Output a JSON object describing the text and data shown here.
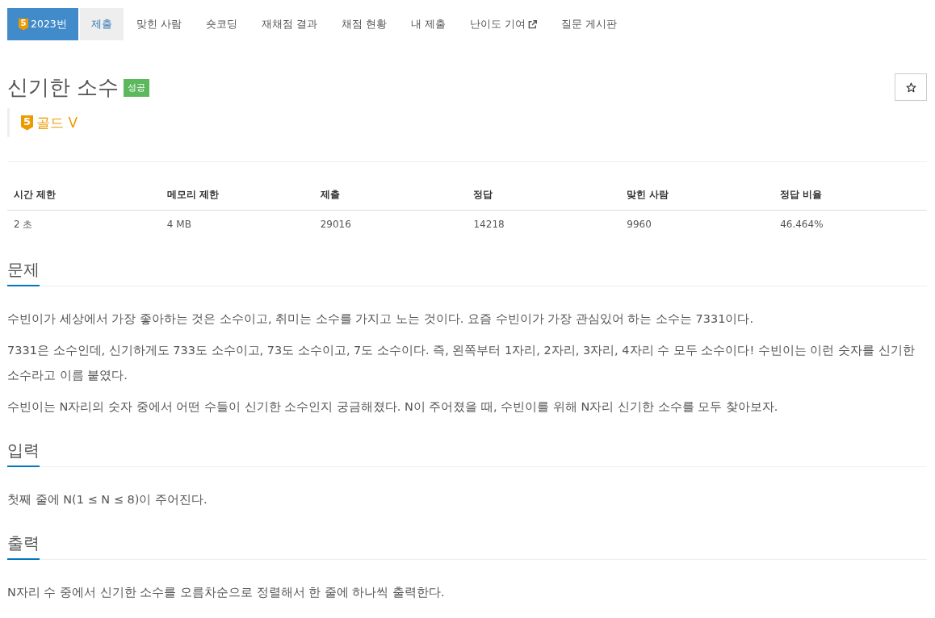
{
  "nav": {
    "tabs": [
      {
        "label": "2023번",
        "kind": "problem",
        "tier_number": "5",
        "selected": true,
        "highlighted": false
      },
      {
        "label": "제출",
        "kind": "link",
        "selected": false,
        "highlighted": true
      },
      {
        "label": "맞힌 사람",
        "kind": "link",
        "selected": false,
        "highlighted": false
      },
      {
        "label": "숏코딩",
        "kind": "link",
        "selected": false,
        "highlighted": false
      },
      {
        "label": "재채점 결과",
        "kind": "link",
        "selected": false,
        "highlighted": false
      },
      {
        "label": "채점 현황",
        "kind": "link",
        "selected": false,
        "highlighted": false
      },
      {
        "label": "내 제출",
        "kind": "link",
        "selected": false,
        "highlighted": false
      },
      {
        "label": "난이도 기여",
        "kind": "external",
        "selected": false,
        "highlighted": false
      },
      {
        "label": "질문 게시판",
        "kind": "link",
        "selected": false,
        "highlighted": false
      }
    ]
  },
  "problem": {
    "title": "신기한 소수",
    "result_badge": "성공",
    "starred": false,
    "tier": {
      "number": "5",
      "name": "골드 V"
    }
  },
  "stats_table": {
    "columns": [
      "시간 제한",
      "메모리 제한",
      "제출",
      "정답",
      "맞힌 사람",
      "정답 비율"
    ],
    "rows": [
      [
        "2 초",
        "4 MB",
        "29016",
        "14218",
        "9960",
        "46.464%"
      ]
    ]
  },
  "sections": [
    {
      "title": "문제",
      "paragraphs": [
        "수빈이가 세상에서 가장 좋아하는 것은 소수이고, 취미는 소수를 가지고 노는 것이다. 요즘 수빈이가 가장 관심있어 하는 소수는 7331이다.",
        "7331은 소수인데, 신기하게도 733도 소수이고, 73도 소수이고, 7도 소수이다. 즉, 왼쪽부터 1자리, 2자리, 3자리, 4자리 수 모두 소수이다! 수빈이는 이런 숫자를 신기한 소수라고 이름 붙였다.",
        "수빈이는 N자리의 숫자 중에서 어떤 수들이 신기한 소수인지 궁금해졌다. N이 주어졌을 때, 수빈이를 위해 N자리 신기한 소수를 모두 찾아보자."
      ]
    },
    {
      "title": "입력",
      "paragraphs": [
        "첫째 줄에 N(1 ≤ N ≤ 8)이 주어진다."
      ]
    },
    {
      "title": "출력",
      "paragraphs": [
        "N자리 수 중에서 신기한 소수를 오름차순으로 정렬해서 한 줄에 하나씩 출력한다."
      ]
    }
  ]
}
